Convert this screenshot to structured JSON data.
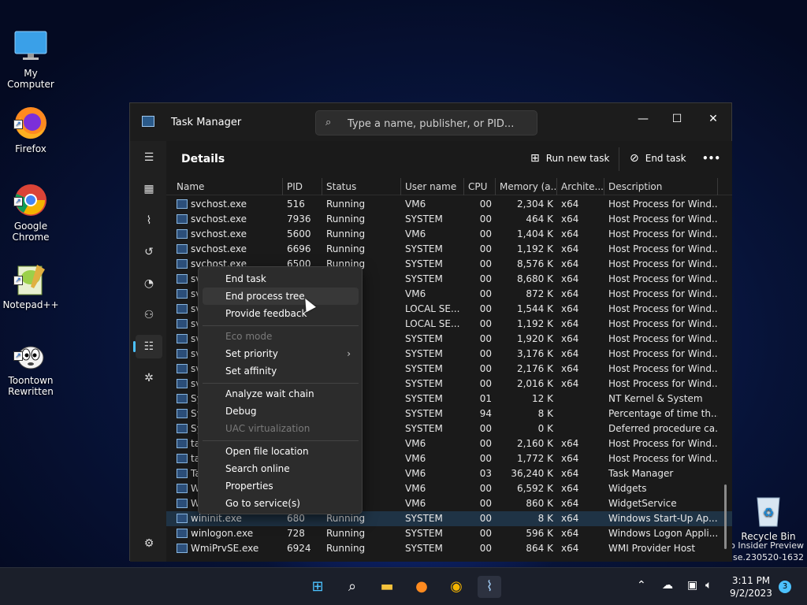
{
  "desktop": {
    "icons": [
      {
        "label": "My Computer",
        "icon": "monitor-icon"
      },
      {
        "label": "Firefox",
        "icon": "firefox-icon"
      },
      {
        "label": "Google\nChrome",
        "icon": "chrome-icon"
      },
      {
        "label": "Notepad++",
        "icon": "notepadpp-icon"
      },
      {
        "label": "Toontown\nRewritten",
        "icon": "toontown-icon"
      },
      {
        "label": "Recycle Bin",
        "icon": "recycle-bin-icon"
      }
    ],
    "watermark_line1": "ro Insider Preview",
    "watermark_line2": "ease.230520-1632"
  },
  "window": {
    "title": "Task Manager",
    "search_placeholder": "Type a name, publisher, or PID...",
    "page_title": "Details",
    "run_new_task": "Run new task",
    "end_task": "End task",
    "more": "•••"
  },
  "columns": [
    "Name",
    "PID",
    "Status",
    "User name",
    "CPU",
    "Memory (a...",
    "Archite...",
    "Description"
  ],
  "rows": [
    {
      "name": "svchost.exe",
      "pid": "516",
      "status": "Running",
      "user": "VM6",
      "cpu": "00",
      "mem": "2,304 K",
      "arch": "x64",
      "desc": "Host Process for Wind..."
    },
    {
      "name": "svchost.exe",
      "pid": "7936",
      "status": "Running",
      "user": "SYSTEM",
      "cpu": "00",
      "mem": "464 K",
      "arch": "x64",
      "desc": "Host Process for Wind..."
    },
    {
      "name": "svchost.exe",
      "pid": "5600",
      "status": "Running",
      "user": "VM6",
      "cpu": "00",
      "mem": "1,404 K",
      "arch": "x64",
      "desc": "Host Process for Wind..."
    },
    {
      "name": "svchost.exe",
      "pid": "6696",
      "status": "Running",
      "user": "SYSTEM",
      "cpu": "00",
      "mem": "1,192 K",
      "arch": "x64",
      "desc": "Host Process for Wind..."
    },
    {
      "name": "svchost.exe",
      "pid": "6500",
      "status": "Running",
      "user": "SYSTEM",
      "cpu": "00",
      "mem": "8,576 K",
      "arch": "x64",
      "desc": "Host Process for Wind..."
    },
    {
      "name": "svc",
      "pid": "",
      "status": "",
      "user": "SYSTEM",
      "cpu": "00",
      "mem": "8,680 K",
      "arch": "x64",
      "desc": "Host Process for Wind..."
    },
    {
      "name": "svc",
      "pid": "",
      "status": "",
      "user": "VM6",
      "cpu": "00",
      "mem": "872 K",
      "arch": "x64",
      "desc": "Host Process for Wind..."
    },
    {
      "name": "svc",
      "pid": "",
      "status": "",
      "user": "LOCAL SE...",
      "cpu": "00",
      "mem": "1,544 K",
      "arch": "x64",
      "desc": "Host Process for Wind..."
    },
    {
      "name": "svc",
      "pid": "",
      "status": "",
      "user": "LOCAL SE...",
      "cpu": "00",
      "mem": "1,192 K",
      "arch": "x64",
      "desc": "Host Process for Wind..."
    },
    {
      "name": "svc",
      "pid": "",
      "status": "",
      "user": "SYSTEM",
      "cpu": "00",
      "mem": "1,920 K",
      "arch": "x64",
      "desc": "Host Process for Wind..."
    },
    {
      "name": "svc",
      "pid": "",
      "status": "",
      "user": "SYSTEM",
      "cpu": "00",
      "mem": "3,176 K",
      "arch": "x64",
      "desc": "Host Process for Wind..."
    },
    {
      "name": "svc",
      "pid": "",
      "status": "",
      "user": "SYSTEM",
      "cpu": "00",
      "mem": "2,176 K",
      "arch": "x64",
      "desc": "Host Process for Wind..."
    },
    {
      "name": "svc",
      "pid": "",
      "status": "",
      "user": "SYSTEM",
      "cpu": "00",
      "mem": "2,016 K",
      "arch": "x64",
      "desc": "Host Process for Wind..."
    },
    {
      "name": "Sy",
      "pid": "",
      "status": "",
      "user": "SYSTEM",
      "cpu": "01",
      "mem": "12 K",
      "arch": "",
      "desc": "NT Kernel & System"
    },
    {
      "name": "Sy",
      "pid": "",
      "status": "",
      "user": "SYSTEM",
      "cpu": "94",
      "mem": "8 K",
      "arch": "",
      "desc": "Percentage of time th..."
    },
    {
      "name": "Sy",
      "pid": "",
      "status": "",
      "user": "SYSTEM",
      "cpu": "00",
      "mem": "0 K",
      "arch": "",
      "desc": "Deferred procedure ca..."
    },
    {
      "name": "tas",
      "pid": "",
      "status": "",
      "user": "VM6",
      "cpu": "00",
      "mem": "2,160 K",
      "arch": "x64",
      "desc": "Host Process for Wind..."
    },
    {
      "name": "tas",
      "pid": "",
      "status": "",
      "user": "VM6",
      "cpu": "00",
      "mem": "1,772 K",
      "arch": "x64",
      "desc": "Host Process for Wind..."
    },
    {
      "name": "Tas",
      "pid": "",
      "status": "",
      "user": "VM6",
      "cpu": "03",
      "mem": "36,240 K",
      "arch": "x64",
      "desc": "Task Manager"
    },
    {
      "name": "Wi",
      "pid": "",
      "status": "",
      "user": "VM6",
      "cpu": "00",
      "mem": "6,592 K",
      "arch": "x64",
      "desc": "Widgets"
    },
    {
      "name": "Wi",
      "pid": "",
      "status": "",
      "user": "VM6",
      "cpu": "00",
      "mem": "860 K",
      "arch": "x64",
      "desc": "WidgetService"
    },
    {
      "name": "wininit.exe",
      "pid": "680",
      "status": "Running",
      "user": "SYSTEM",
      "cpu": "00",
      "mem": "8 K",
      "arch": "x64",
      "desc": "Windows Start-Up Ap..."
    },
    {
      "name": "winlogon.exe",
      "pid": "728",
      "status": "Running",
      "user": "SYSTEM",
      "cpu": "00",
      "mem": "596 K",
      "arch": "x64",
      "desc": "Windows Logon Appli..."
    },
    {
      "name": "WmiPrvSE.exe",
      "pid": "6924",
      "status": "Running",
      "user": "SYSTEM",
      "cpu": "00",
      "mem": "864 K",
      "arch": "x64",
      "desc": "WMI Provider Host"
    }
  ],
  "selected_row": 21,
  "context_menu": {
    "end_task": "End task",
    "end_process_tree": "End process tree",
    "provide_feedback": "Provide feedback",
    "eco_mode": "Eco mode",
    "set_priority": "Set priority",
    "set_affinity": "Set affinity",
    "analyze_wait_chain": "Analyze wait chain",
    "debug": "Debug",
    "uac_virtualization": "UAC virtualization",
    "open_file_location": "Open file location",
    "search_online": "Search online",
    "properties": "Properties",
    "go_to_services": "Go to service(s)",
    "submenu_arrow": "›"
  },
  "taskbar": {
    "time": "3:11 PM",
    "date": "9/2/2023",
    "notification_count": "3"
  },
  "colors": {
    "accent": "#4cc2ff",
    "selected_row": "#1f3345"
  }
}
